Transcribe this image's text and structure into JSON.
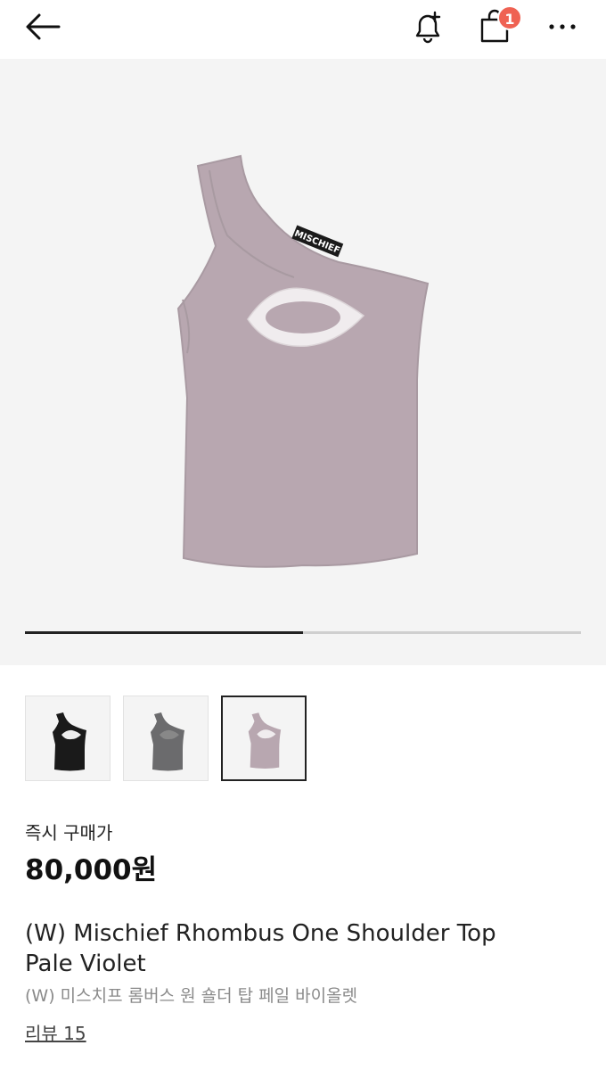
{
  "header": {
    "cart_count": "1"
  },
  "product_image": {
    "logo_text": "MISCHIEF",
    "colors": {
      "background": "#f4f4f4",
      "garment": "#b8a7b0",
      "cutout": "#f0ecee"
    }
  },
  "carousel": {
    "current": 1,
    "total": 2,
    "progress": 0.5
  },
  "thumbnails": [
    {
      "color_name": "black",
      "color": "#1a1a1a",
      "selected": false
    },
    {
      "color_name": "gray",
      "color": "#6b6b6d",
      "selected": false
    },
    {
      "color_name": "pale violet",
      "color": "#b8a7b0",
      "selected": true
    }
  ],
  "purchase": {
    "label": "즉시 구매가",
    "price": "80,000원"
  },
  "product": {
    "title_line1": "(W) Mischief Rhombus One Shoulder Top",
    "title_line2": "Pale Violet",
    "subtitle": "(W) 미스치프 롬버스 원 숄더 탑 페일 바이올렛",
    "reviews_link": "리뷰 15"
  },
  "colors": {
    "accent_badge": "#ef6253",
    "text": "#222222",
    "muted": "#8a8a8a"
  }
}
